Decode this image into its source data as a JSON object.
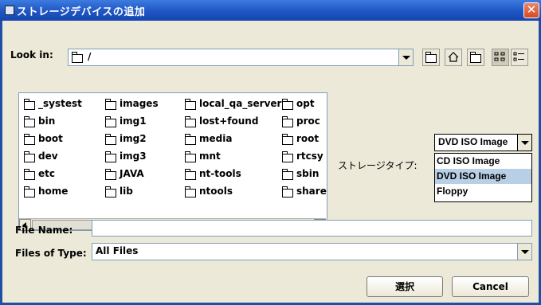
{
  "window": {
    "title": "ストレージデバイスの追加",
    "close_glyph": "✕"
  },
  "look_in": {
    "label": "Look in:",
    "value": "/"
  },
  "toolbar": {
    "icons": [
      "up-folder-icon",
      "home-icon",
      "new-folder-icon",
      "list-view-icon",
      "details-view-icon"
    ]
  },
  "files": {
    "columns": [
      [
        "_systest",
        "bin",
        "boot",
        "dev",
        "etc",
        "home"
      ],
      [
        "images",
        "img1",
        "img2",
        "img3",
        "JAVA",
        "lib"
      ],
      [
        "local_qa_server",
        "lost+found",
        "media",
        "mnt",
        "nt-tools",
        "ntools"
      ],
      [
        "opt",
        "proc",
        "root",
        "rtcsy",
        "sbin",
        "share"
      ]
    ]
  },
  "storage_type": {
    "label": "ストレージタイプ:",
    "selected": "DVD ISO Image",
    "options": [
      "CD ISO Image",
      "DVD ISO Image",
      "Floppy"
    ],
    "highlighted_index": 1
  },
  "file_name": {
    "label": "File Name:",
    "value": ""
  },
  "files_of_type": {
    "label": "Files of Type:",
    "value": "All Files"
  },
  "buttons": {
    "select": "選択",
    "cancel": "Cancel"
  }
}
